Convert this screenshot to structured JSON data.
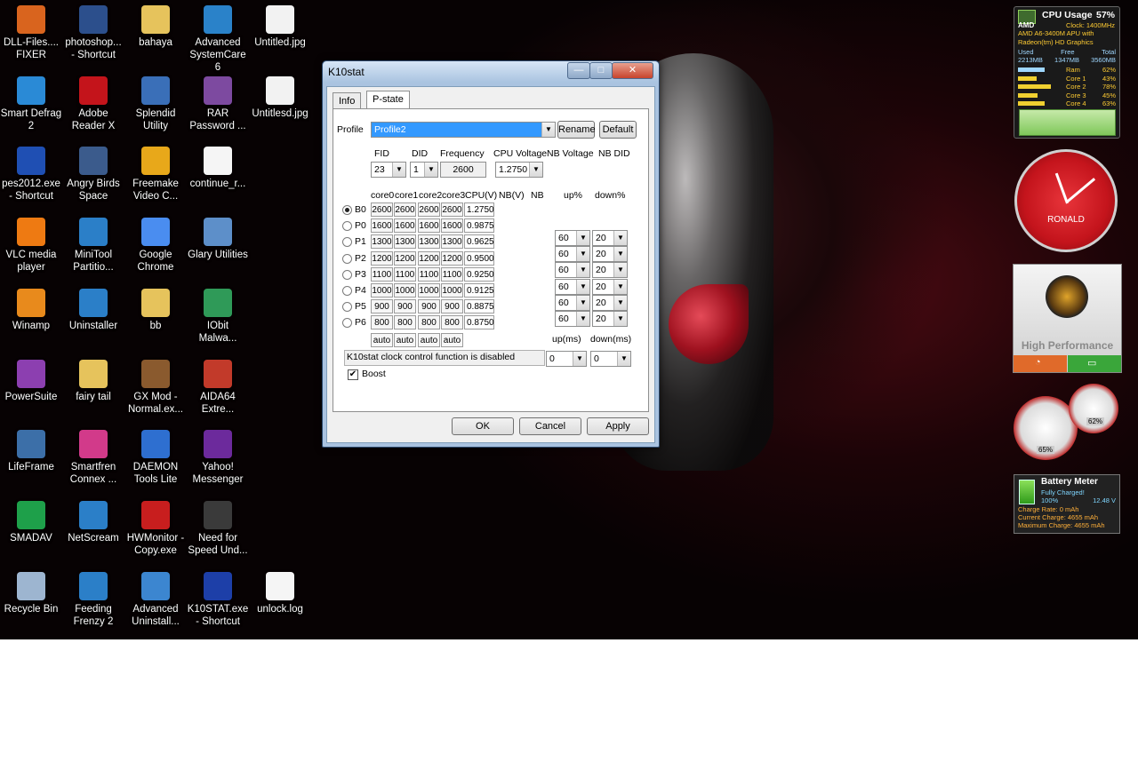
{
  "desktop_icons": [
    {
      "label": "DLL-Files.... FIXER",
      "icon": "dll-fixer-icon",
      "color": "#d9641e"
    },
    {
      "label": "photoshop... - Shortcut",
      "icon": "photoshop-icon",
      "color": "#2c4f8c"
    },
    {
      "label": "bahaya",
      "icon": "folder-icon",
      "color": "#e6c35c"
    },
    {
      "label": "Advanced SystemCare 6",
      "icon": "systemcare-icon",
      "color": "#2a82c9"
    },
    {
      "label": "Untitled.jpg",
      "icon": "image-file-icon",
      "color": "#f2f2f2"
    },
    {
      "label": "Smart Defrag 2",
      "icon": "smart-defrag-icon",
      "color": "#2a8ad6"
    },
    {
      "label": "Adobe Reader X",
      "icon": "adobe-reader-icon",
      "color": "#c4141b"
    },
    {
      "label": "Splendid Utility",
      "icon": "splendid-icon",
      "color": "#3a6fb8"
    },
    {
      "label": "RAR Password ...",
      "icon": "rar-password-icon",
      "color": "#7d4aa0"
    },
    {
      "label": "Untitlesd.jpg",
      "icon": "image-file-icon",
      "color": "#f2f2f2"
    },
    {
      "label": "pes2012.exe - Shortcut",
      "icon": "pes-icon",
      "color": "#1f4fb3"
    },
    {
      "label": "Angry Birds Space",
      "icon": "angry-birds-icon",
      "color": "#3b5b8c"
    },
    {
      "label": "Freemake Video C...",
      "icon": "freemake-icon",
      "color": "#e8a81a"
    },
    {
      "label": "continue_r...",
      "icon": "document-icon",
      "color": "#f5f5f5"
    },
    {
      "label": "VLC media player",
      "icon": "vlc-icon",
      "color": "#ee7a12"
    },
    {
      "label": "MiniTool Partitio...",
      "icon": "minitool-icon",
      "color": "#2b7fc8"
    },
    {
      "label": "Google Chrome",
      "icon": "chrome-icon",
      "color": "#4a8df0"
    },
    {
      "label": "Glary Utilities",
      "icon": "glary-icon",
      "color": "#5d8fc9"
    },
    {
      "label": "Winamp",
      "icon": "winamp-icon",
      "color": "#e88a1c"
    },
    {
      "label": "Uninstaller",
      "icon": "uninstaller-icon",
      "color": "#2b7fc8"
    },
    {
      "label": "bb",
      "icon": "folder-icon",
      "color": "#e6c35c"
    },
    {
      "label": "IObit Malwa...",
      "icon": "iobit-icon",
      "color": "#2f9a58"
    },
    {
      "label": "PowerSuite",
      "icon": "powersuite-icon",
      "color": "#8c3fb0"
    },
    {
      "label": "fairy tail",
      "icon": "folder-icon",
      "color": "#e6c35c"
    },
    {
      "label": "GX Mod - Normal.ex...",
      "icon": "gx-mod-icon",
      "color": "#8a5a2e"
    },
    {
      "label": "AIDA64 Extre...",
      "icon": "aida64-icon",
      "color": "#c23a2a"
    },
    {
      "label": "LifeFrame",
      "icon": "lifeframe-icon",
      "color": "#3c6fa8"
    },
    {
      "label": "Smartfren Connex ...",
      "icon": "smartfren-icon",
      "color": "#d23a8a"
    },
    {
      "label": "DAEMON Tools Lite",
      "icon": "daemon-tools-icon",
      "color": "#2e6fd0"
    },
    {
      "label": "Yahoo! Messenger",
      "icon": "yahoo-icon",
      "color": "#6c2a9c"
    },
    {
      "label": "SMADAV",
      "icon": "smadav-icon",
      "color": "#1ea04a"
    },
    {
      "label": "NetScream",
      "icon": "netscream-icon",
      "color": "#2b7fc8"
    },
    {
      "label": "HWMonitor - Copy.exe",
      "icon": "hwmonitor-icon",
      "color": "#c81e1e"
    },
    {
      "label": "Need for Speed Und...",
      "icon": "nfs-icon",
      "color": "#3a3a3a"
    },
    {
      "label": "Recycle Bin",
      "icon": "recycle-bin-icon",
      "color": "#9db5d0"
    },
    {
      "label": "Feeding Frenzy 2",
      "icon": "feeding-frenzy-icon",
      "color": "#2b7fc8"
    },
    {
      "label": "Advanced Uninstall...",
      "icon": "adv-uninstall-icon",
      "color": "#3c86d0"
    },
    {
      "label": "K10STAT.exe - Shortcut",
      "icon": "k10stat-icon",
      "color": "#1d3fa8"
    },
    {
      "label": "unlock.log",
      "icon": "document-icon",
      "color": "#f5f5f5"
    }
  ],
  "window": {
    "title": "K10stat",
    "minimize": "—",
    "maximize": "□",
    "close": "✕",
    "tabs": [
      "Info",
      "P-state"
    ],
    "active_tab": "P-state",
    "profile_label": "Profile",
    "profile_value": "Profile2",
    "rename_label": "Rename",
    "default_label": "Default",
    "fid_header": "FID",
    "did_header": "DID",
    "freq_header": "Frequency",
    "cpuv_header": "CPU Voltage",
    "nbv_header": "NB Voltage",
    "nbdid_header": "NB DID",
    "fid_value": "23",
    "did_value": "1",
    "freq_value": "2600",
    "cpuv_value": "1.2750",
    "col_headers": [
      "core0",
      "core1",
      "core2",
      "core3",
      "CPU(V)",
      "NB(V)",
      "NB",
      "up%",
      "down%"
    ],
    "pstates": [
      {
        "name": "B0",
        "cores": [
          "2600",
          "2600",
          "2600",
          "2600"
        ],
        "cpuv": "1.2750",
        "selected": true
      },
      {
        "name": "P0",
        "cores": [
          "1600",
          "1600",
          "1600",
          "1600"
        ],
        "cpuv": "0.9875"
      },
      {
        "name": "P1",
        "cores": [
          "1300",
          "1300",
          "1300",
          "1300"
        ],
        "cpuv": "0.9625"
      },
      {
        "name": "P2",
        "cores": [
          "1200",
          "1200",
          "1200",
          "1200"
        ],
        "cpuv": "0.9500"
      },
      {
        "name": "P3",
        "cores": [
          "1100",
          "1100",
          "1100",
          "1100"
        ],
        "cpuv": "0.9250"
      },
      {
        "name": "P4",
        "cores": [
          "1000",
          "1000",
          "1000",
          "1000"
        ],
        "cpuv": "0.9125"
      },
      {
        "name": "P5",
        "cores": [
          "900",
          "900",
          "900",
          "900"
        ],
        "cpuv": "0.8875"
      },
      {
        "name": "P6",
        "cores": [
          "800",
          "800",
          "800",
          "800"
        ],
        "cpuv": "0.8750"
      }
    ],
    "auto_values": [
      "auto",
      "auto",
      "auto",
      "auto"
    ],
    "thresholds": [
      {
        "up": "60",
        "down": "20"
      },
      {
        "up": "60",
        "down": "20"
      },
      {
        "up": "60",
        "down": "20"
      },
      {
        "up": "60",
        "down": "20"
      },
      {
        "up": "60",
        "down": "20"
      },
      {
        "up": "60",
        "down": "20"
      }
    ],
    "upms_label": "up(ms)",
    "downms_label": "down(ms)",
    "upms_value": "0",
    "downms_value": "0",
    "status_text": "K10stat clock control function is disabled",
    "boost_label": "Boost",
    "boost_checked": true,
    "ok_label": "OK",
    "cancel_label": "Cancel",
    "apply_label": "Apply"
  },
  "cpu_gadget": {
    "title": "CPU Usage",
    "usage": "57%",
    "brand": "AMD",
    "clock": "Clock: 1400MHz",
    "cpu_name": "AMD A6-3400M APU with Radeon(tm) HD Graphics",
    "mem_headers": [
      "Used",
      "Free",
      "Total"
    ],
    "mem_values": [
      "2213MB",
      "1347MB",
      "3560MB"
    ],
    "rows": [
      {
        "label": "Ram",
        "value": "62%",
        "fill": 0.62
      },
      {
        "label": "Core 1",
        "value": "43%",
        "fill": 0.43
      },
      {
        "label": "Core 2",
        "value": "78%",
        "fill": 0.78
      },
      {
        "label": "Core 3",
        "value": "45%",
        "fill": 0.45
      },
      {
        "label": "Core 4",
        "value": "63%",
        "fill": 0.63
      }
    ]
  },
  "clock_gadget": {
    "label": "RONALD"
  },
  "power_gadget": {
    "label": "High Performance"
  },
  "meter_gadget": {
    "cpu": "65%",
    "ram": "62%"
  },
  "battery_gadget": {
    "title": "Battery Meter",
    "status": "Fully Charged!",
    "percent": "100%",
    "voltage": "12.48 V",
    "charge_rate": "Charge Rate: 0 mAh",
    "current_charge": "Current Charge: 4655 mAh",
    "max_charge": "Maximum Charge: 4655 mAh"
  }
}
